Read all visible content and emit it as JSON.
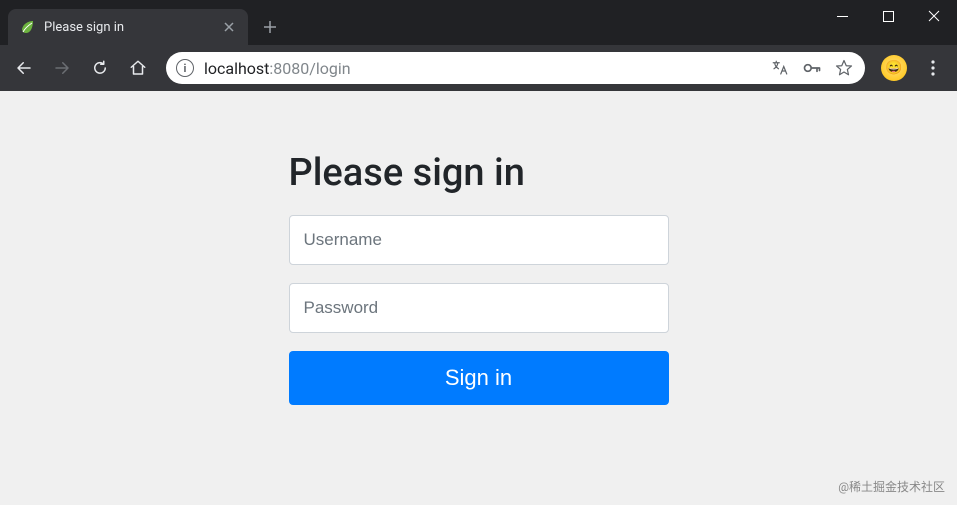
{
  "browser": {
    "tab": {
      "title": "Please sign in"
    },
    "url": {
      "host": "localhost",
      "port": ":8080",
      "path": "/login"
    }
  },
  "form": {
    "heading": "Please sign in",
    "username_placeholder": "Username",
    "password_placeholder": "Password",
    "submit_label": "Sign in"
  },
  "watermark": "@稀土掘金技术社区"
}
